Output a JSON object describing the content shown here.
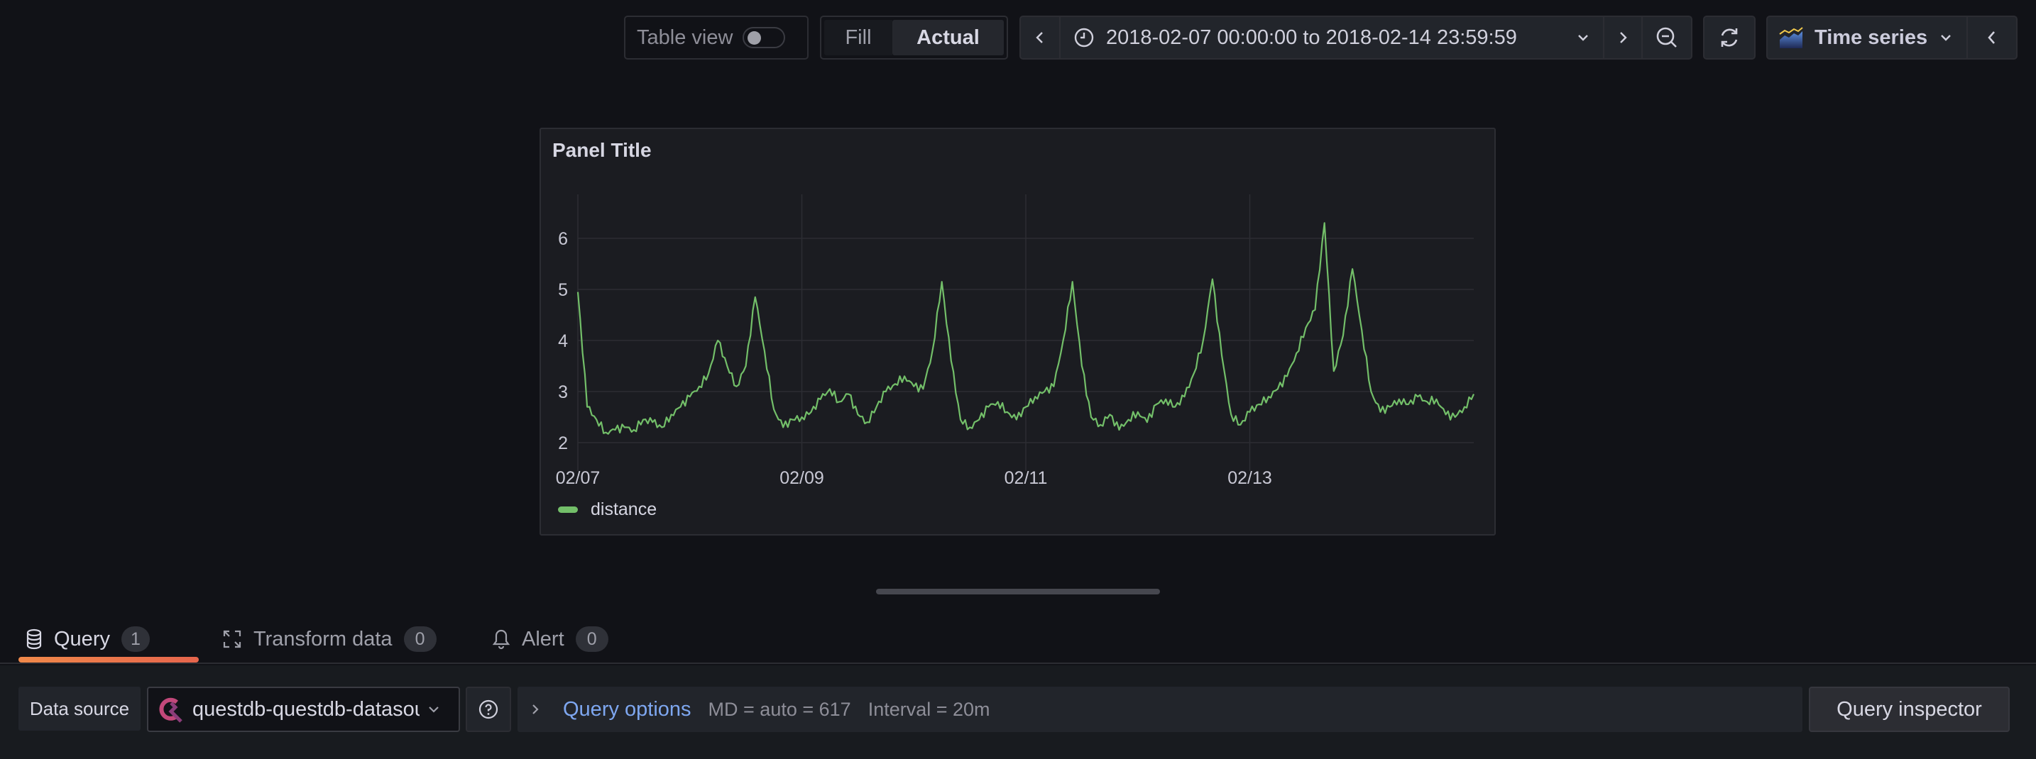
{
  "toolbar": {
    "table_view_label": "Table view",
    "table_view_on": false,
    "fill_label": "Fill",
    "actual_label": "Actual",
    "actual_selected": true,
    "time_range": "2018-02-07 00:00:00 to 2018-02-14 23:59:59",
    "viz_type": "Time series",
    "icons": {
      "prev": "chevron-left-icon",
      "clock": "clock-icon",
      "dropdown": "chevron-down-icon",
      "next": "chevron-right-icon",
      "zoom_out": "zoom-out-icon",
      "refresh": "refresh-icon",
      "viz": "time-series-icon",
      "collapse": "chevron-left-icon"
    }
  },
  "panel": {
    "title": "Panel Title",
    "legend": [
      {
        "name": "distance",
        "color": "#73bf69"
      }
    ]
  },
  "chart_data": {
    "type": "line",
    "title": "Panel Title",
    "xlabel": "",
    "ylabel": "",
    "x_start": "2018-02-07 00:00",
    "x_end": "2018-02-14 23:59",
    "x_step_hours": 2,
    "x_ticks": [
      "02/07",
      "02/09",
      "02/11",
      "02/13"
    ],
    "x_tick_days": [
      0,
      2,
      4,
      6
    ],
    "y_ticks": [
      2,
      3,
      4,
      5,
      6
    ],
    "ylim": [
      1.7,
      6.8
    ],
    "grid": true,
    "legend_position": "bottom-left",
    "series": [
      {
        "name": "distance",
        "color": "#73bf69",
        "values": [
          4.95,
          2.7,
          2.45,
          2.2,
          2.25,
          2.3,
          2.25,
          2.45,
          2.4,
          2.3,
          2.55,
          2.7,
          2.9,
          3.1,
          3.35,
          4.0,
          3.5,
          3.1,
          3.5,
          4.85,
          3.8,
          2.65,
          2.3,
          2.45,
          2.5,
          2.6,
          2.85,
          3.05,
          2.8,
          2.95,
          2.55,
          2.4,
          2.7,
          3.0,
          3.15,
          3.3,
          3.1,
          3.05,
          3.8,
          5.15,
          3.6,
          2.45,
          2.3,
          2.45,
          2.7,
          2.8,
          2.6,
          2.45,
          2.7,
          2.9,
          3.0,
          3.1,
          4.0,
          5.15,
          3.5,
          2.5,
          2.35,
          2.55,
          2.25,
          2.45,
          2.6,
          2.4,
          2.75,
          2.85,
          2.7,
          2.9,
          3.35,
          4.0,
          5.2,
          3.7,
          2.55,
          2.35,
          2.6,
          2.75,
          2.9,
          3.05,
          3.3,
          3.75,
          4.25,
          4.6,
          6.3,
          3.4,
          4.1,
          5.4,
          4.2,
          3.0,
          2.6,
          2.7,
          2.85,
          2.75,
          2.9,
          2.8,
          2.85,
          2.55,
          2.5,
          2.7,
          2.95
        ]
      }
    ]
  },
  "tabs": [
    {
      "label": "Query",
      "count": "1",
      "icon": "database-icon",
      "active": true
    },
    {
      "label": "Transform data",
      "count": "0",
      "icon": "transform-icon",
      "active": false
    },
    {
      "label": "Alert",
      "count": "0",
      "icon": "bell-icon",
      "active": false
    }
  ],
  "query_row": {
    "data_source_label": "Data source",
    "data_source_value": "questdb-questdb-datasource",
    "data_source_icon": "questdb-logo-icon",
    "help_icon": "help-circle-icon",
    "query_options_label": "Query options",
    "md": "MD = auto = 617",
    "interval": "Interval = 20m",
    "query_inspector_label": "Query inspector"
  }
}
